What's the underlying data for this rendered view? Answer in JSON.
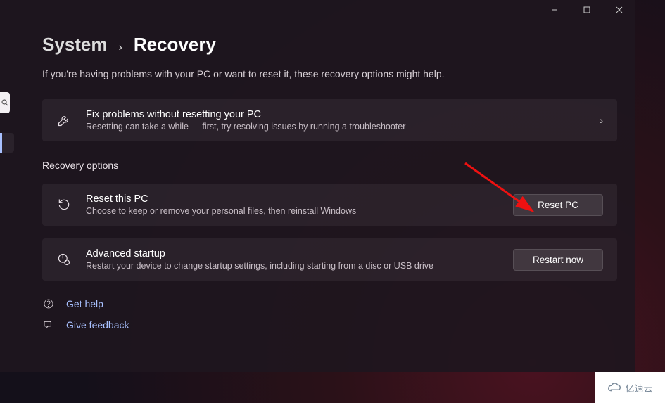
{
  "breadcrumb": {
    "parent": "System",
    "current": "Recovery"
  },
  "subtitle": "If you're having problems with your PC or want to reset it, these recovery options might help.",
  "troubleshoot": {
    "title": "Fix problems without resetting your PC",
    "desc": "Resetting can take a while — first, try resolving issues by running a troubleshooter"
  },
  "section_label": "Recovery options",
  "reset": {
    "title": "Reset this PC",
    "desc": "Choose to keep or remove your personal files, then reinstall Windows",
    "button": "Reset PC"
  },
  "advanced": {
    "title": "Advanced startup",
    "desc": "Restart your device to change startup settings, including starting from a disc or USB drive",
    "button": "Restart now"
  },
  "links": {
    "help": "Get help",
    "feedback": "Give feedback"
  },
  "watermark": "亿速云"
}
